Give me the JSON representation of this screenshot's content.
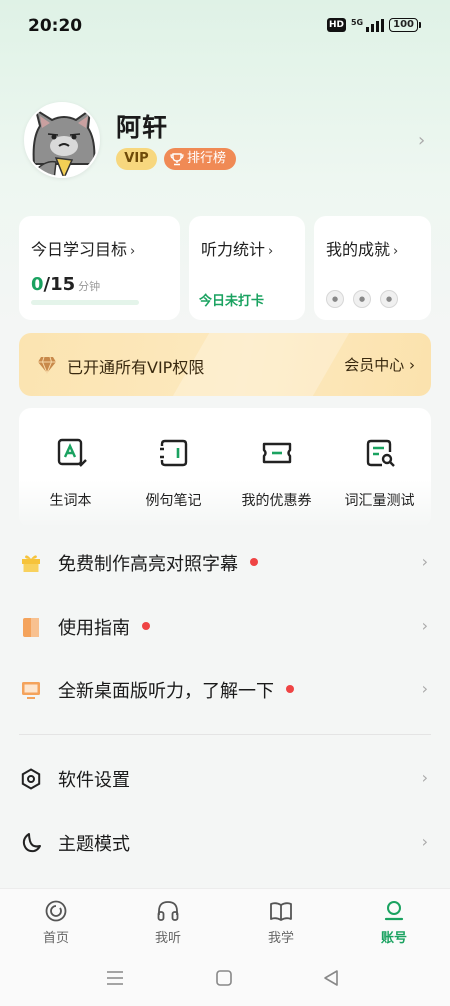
{
  "status_bar": {
    "time": "20:20",
    "hd": "HD",
    "network": "5G",
    "battery": "100"
  },
  "profile": {
    "username": "阿轩",
    "vip_badge": "VIP",
    "rank_badge": "排行榜"
  },
  "cards": {
    "goal": {
      "title": "今日学习目标",
      "current": "0",
      "target": "/15",
      "unit": "分钟",
      "progress": 0
    },
    "listening": {
      "title": "听力统计",
      "status": "今日未打卡"
    },
    "achievements": {
      "title": "我的成就"
    }
  },
  "vip_banner": {
    "text": "已开通所有VIP权限",
    "center": "会员中心"
  },
  "tools": [
    {
      "label": "生词本",
      "icon": "vocab-book-icon"
    },
    {
      "label": "例句笔记",
      "icon": "sentence-notes-icon"
    },
    {
      "label": "我的优惠券",
      "icon": "coupon-icon"
    },
    {
      "label": "词汇量测试",
      "icon": "vocab-test-icon"
    }
  ],
  "menu": [
    {
      "label": "免费制作高亮对照字幕",
      "icon": "gift-icon",
      "dot": true
    },
    {
      "label": "使用指南",
      "icon": "guide-book-icon",
      "dot": true
    },
    {
      "label": "全新桌面版听力，了解一下",
      "icon": "monitor-icon",
      "dot": true
    }
  ],
  "settings": [
    {
      "label": "软件设置",
      "icon": "settings-icon"
    },
    {
      "label": "主题模式",
      "icon": "moon-icon"
    }
  ],
  "tabs": [
    {
      "label": "首页",
      "icon": "home-icon"
    },
    {
      "label": "我听",
      "icon": "headphones-icon"
    },
    {
      "label": "我学",
      "icon": "open-book-icon"
    },
    {
      "label": "账号",
      "icon": "account-icon",
      "active": true
    }
  ],
  "colors": {
    "accent": "#1aa260",
    "vip_gold": "#f7d77e",
    "rank_orange": "#f08a55",
    "dot_red": "#ef4444"
  }
}
